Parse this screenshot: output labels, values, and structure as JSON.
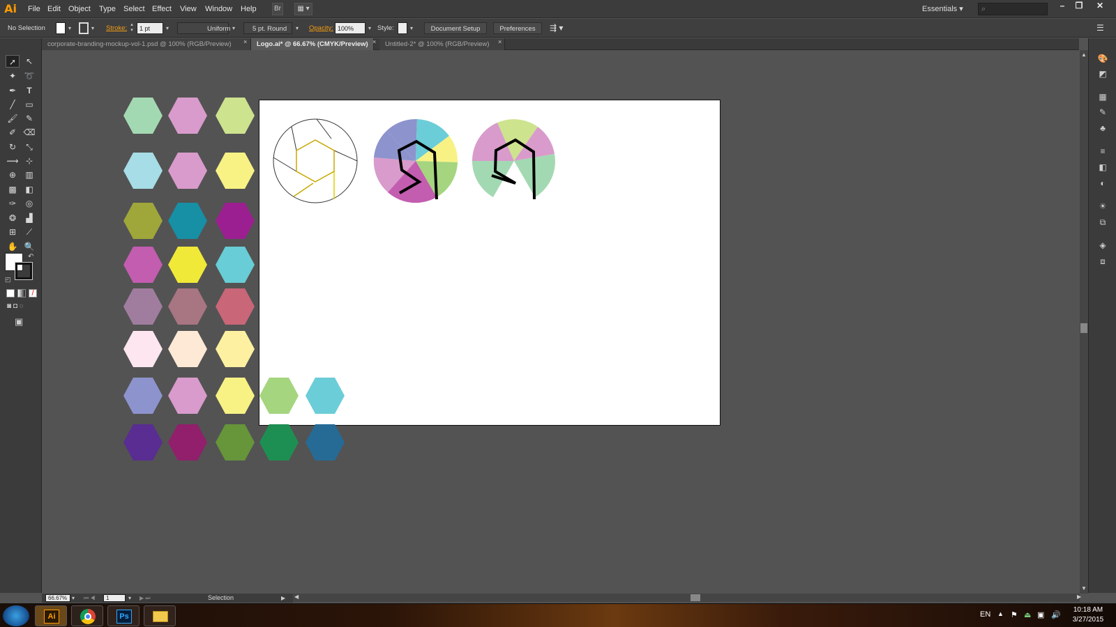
{
  "app": {
    "logo": "Ai",
    "workspace": "Essentials ▾",
    "search_placeholder": "⌕"
  },
  "menu": [
    "File",
    "Edit",
    "Object",
    "Type",
    "Select",
    "Effect",
    "View",
    "Window",
    "Help"
  ],
  "menu_buttons": {
    "bridge": "Br",
    "arrange": "▦ ▾"
  },
  "window_controls": {
    "minimize": "–",
    "restore": "❐",
    "close": "✕"
  },
  "control_bar": {
    "selection": "No Selection",
    "stroke_label": "Stroke:",
    "stroke_weight": "1 pt",
    "profile": "Uniform",
    "brush": "5 pt. Round",
    "opacity_label": "Opacity:",
    "opacity": "100%",
    "style_label": "Style:",
    "document_setup": "Document Setup",
    "preferences": "Preferences"
  },
  "tabs": [
    {
      "label": "corporate-branding-mockup-vol-1.psd @ 100% (RGB/Preview)",
      "close": "×"
    },
    {
      "label": "Logo.ai* @ 66.67% (CMYK/Preview)",
      "close": "×"
    },
    {
      "label": "Untitled-2* @ 100% (RGB/Preview)",
      "close": "×"
    }
  ],
  "status_bar": {
    "zoom": "66.67%",
    "artboard": "1",
    "tool": "Selection"
  },
  "swatch_colors": [
    [
      "#a3d9b2",
      "#d89bcb",
      "#cde38e"
    ],
    [
      "#a6dde6",
      "#d89bcb",
      "#f8f285"
    ],
    [
      "#9fa63a",
      "#178fa5",
      "#9c1f91"
    ],
    [
      "#c35db0",
      "#f0e938",
      "#68cdd6"
    ],
    [
      "#a07d9f",
      "#a87582",
      "#c96678"
    ],
    [
      "#fde6ef",
      "#fde9d5",
      "#fdf0a0"
    ],
    [
      "#8d93cd",
      "#d89bcb",
      "#f8f285",
      "#a5d57e",
      "#6bcdd7"
    ],
    [
      "#592d92",
      "#911f6c",
      "#66953a",
      "#1e8f52",
      "#266b96"
    ]
  ],
  "taskbar": {
    "apps": [
      {
        "label": "Ai"
      },
      {
        "label": "Chrome"
      },
      {
        "label": "Ps"
      },
      {
        "label": "Explorer"
      }
    ],
    "lang": "EN",
    "time": "10:18 AM",
    "date": "3/27/2015"
  }
}
